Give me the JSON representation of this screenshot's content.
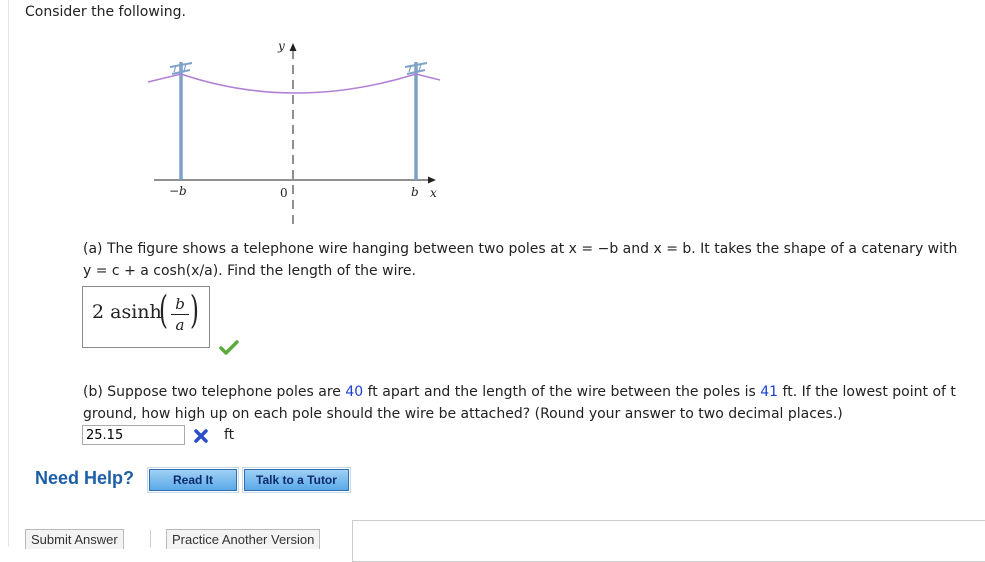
{
  "intro": "Consider the following.",
  "figure": {
    "y_axis_label": "y",
    "x_axis_label": "x",
    "neg_b_label": "−b",
    "origin_label": "0",
    "b_label": "b"
  },
  "part_a": {
    "line1": "(a) The figure shows a telephone wire hanging between two poles at x = −b and x = b. It takes the shape of a catenary with",
    "line2": "y = c + a cosh(x/a).  Find the length of the wire.",
    "answer_prefix": "2 asinh",
    "answer_numerator": "b",
    "answer_denominator": "a",
    "status": "correct"
  },
  "part_b": {
    "line1_pre": "(b) Suppose two telephone poles are ",
    "distance": "40",
    "line1_mid": " ft apart and the length of the wire between the poles is ",
    "length": "41",
    "line1_post": " ft. If the lowest point of t",
    "line2": "ground, how high up on each pole should the wire be attached? (Round your answer to two decimal places.)",
    "answer_value": "25.15",
    "unit": "ft",
    "status": "incorrect"
  },
  "help": {
    "label": "Need Help?",
    "read_it": "Read It",
    "talk_tutor": "Talk to a Tutor"
  },
  "footer": {
    "submit": "Submit Answer",
    "practice": "Practice Another Version"
  },
  "colors": {
    "link_blue": "#1c5fa7",
    "number_blue": "#1a3fd1",
    "check_green": "#5aab3c",
    "cross_blue": "#2b4fc7",
    "wire_purple": "#b07fd6",
    "pole_blue": "#7ea1c8"
  }
}
